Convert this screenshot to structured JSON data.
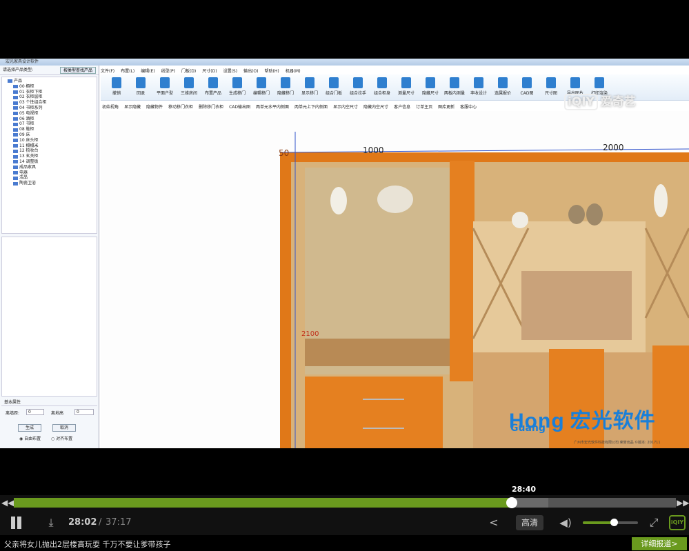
{
  "app": {
    "title": "宏光家具设计软件",
    "menu": [
      "文件(F)",
      "布置(L)",
      "编辑(E)",
      "线型(P)",
      "门板(D)",
      "尺寸(D)",
      "设置(S)",
      "输出(O)",
      "帮助(H)",
      "机器(M)"
    ],
    "toolbar": [
      "撤销",
      "回退",
      "平面户型",
      "三维房间",
      "布置产品",
      "生成移门",
      "编辑移门",
      "隐藏移门",
      "显示移门",
      "组合门板",
      "组合拉手",
      "组合柜身",
      "测量尺寸",
      "隐藏尺寸",
      "两板内测量",
      "丰收设计",
      "选属报价",
      "CAD图",
      "尺寸图",
      "导出图片",
      "打印渲染"
    ],
    "toolbar2": [
      "初始视角",
      "显示隐藏",
      "隐藏物件",
      "移动移门衣柜",
      "删除移门衣柜",
      "CAD输出图",
      "两单元水平内侧面",
      "两单元上下内侧面",
      "显示内空尺寸",
      "隐藏内空尺寸",
      "客户信息",
      "订单主页",
      "图库更新",
      "客服中心"
    ],
    "left_panel": {
      "header": "请选择产品类型:",
      "search_button": "按类型查找产品",
      "tree_root": "产品",
      "tree_items": [
        "00 橱柜",
        "01 衣柜下柜",
        "02 衣柜层柜",
        "03 个性组合柜",
        "04 书柜系列",
        "05 电视柜",
        "06 酒柜",
        "07 书柜",
        "08 鞋柜",
        "09 床",
        "10 床头柜",
        "11 榻榻米",
        "12 梳妆台",
        "13 玄关柜",
        "14 调整板",
        "成品家具",
        "电器",
        "洁品",
        "陶瓷卫浴"
      ],
      "props_header": "基本属性",
      "field1_label": "离墙距:",
      "field1_value": "0",
      "field2_label": "离地高",
      "field2_value": "0",
      "btn_generate": "生成",
      "btn_cancel": "取消",
      "radio1": "自由布置",
      "radio2": "对齐布置"
    },
    "dimensions": {
      "d1": "50",
      "d2": "1000",
      "d3": "2000",
      "d4": "2100"
    },
    "brand": {
      "latin": "Hong",
      "cn": "宏光软件",
      "latin2": "Guang"
    },
    "footer_copy": "广州市宏光软件科技有限公司 荣誉出品 ©版本: 201711"
  },
  "watermark": {
    "logo": "iQIY",
    "text": "爱奇艺"
  },
  "player": {
    "hover_time": "28:40",
    "current_time": "28:02",
    "separator": "/",
    "total_time": "37:17",
    "progress_fraction": 0.752,
    "quality": "高清",
    "brand_small": "iQIY",
    "news_text": "父亲将女儿抛出2层楼高玩耍 千万不要让爹带孩子",
    "news_button": "详细报道>"
  },
  "colors": {
    "accent": "#6a9a1e",
    "brand_blue": "#1a7fd8",
    "cabinet_orange": "#e07818"
  }
}
